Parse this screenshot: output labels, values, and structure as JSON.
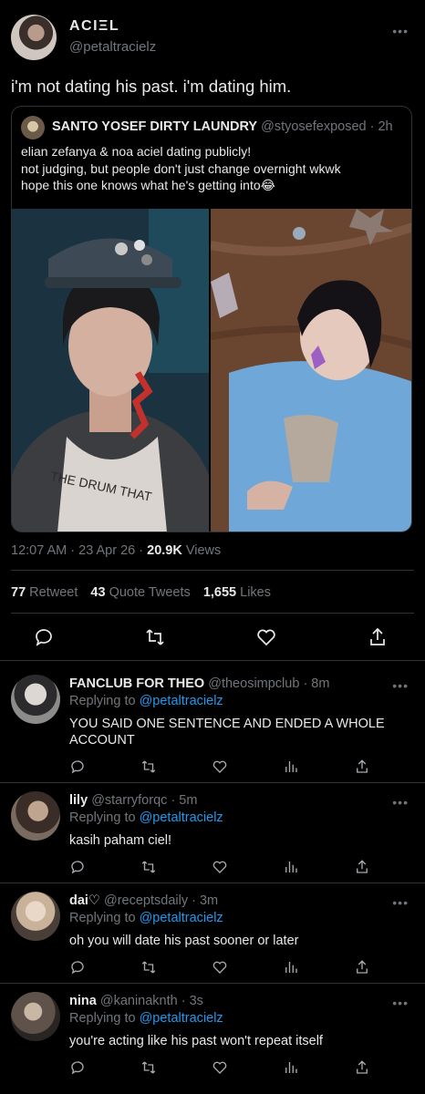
{
  "main_tweet": {
    "display_name": "ACIΞL",
    "handle": "@petaltracielz",
    "text": "i'm not dating his past. i'm dating him.",
    "more": "•••"
  },
  "quoted_tweet": {
    "display_name": "SANTO YOSEF DIRTY LAUNDRY",
    "handle": "@styosefexposed",
    "time": "· 2h",
    "lines": [
      "elian zefanya & noa aciel dating publicly!",
      "not judging, but people don't just change overnight wkwk",
      "hope this one knows what he's getting into😂"
    ],
    "left_image_overlay_text": "THE DRUM THAT"
  },
  "meta": {
    "timestamp": "12:07 AM · 23 Apr 26 ·",
    "views_count": "20.9K",
    "views_label": "Views"
  },
  "stats": {
    "retweets_count": "77",
    "retweets_label": "Retweet",
    "quotes_count": "43",
    "quotes_label": "Quote Tweets",
    "likes_count": "1,655",
    "likes_label": "Likes"
  },
  "replies": [
    {
      "name": "FANCLUB FOR THEO",
      "handle": "@theosimpclub",
      "time": "· 8m",
      "replying_prefix": "Replying to",
      "replying_to": "@petaltracielz",
      "text_lines": [
        "YOU SAID ONE SENTENCE AND ENDED A WHOLE",
        "ACCOUNT"
      ]
    },
    {
      "name": "lily",
      "handle": "@starryforqc",
      "time": "· 5m",
      "replying_prefix": "Replying to",
      "replying_to": "@petaltracielz",
      "text_lines": [
        "kasih paham ciel!"
      ]
    },
    {
      "name": "dai♡",
      "handle": "@receptsdaily",
      "time": "· 3m",
      "replying_prefix": "Replying to",
      "replying_to": "@petaltracielz",
      "text_lines": [
        "oh you will date his past sooner or later"
      ]
    },
    {
      "name": "nina",
      "handle": "@kaninaknth",
      "time": "· 3s",
      "replying_prefix": "Replying to",
      "replying_to": "@petaltracielz",
      "text_lines": [
        "you're acting like his past won't repeat itself"
      ]
    }
  ],
  "colors": {
    "background": "#000000",
    "text": "#e7e9ea",
    "muted": "#71767b",
    "link": "#1d9bf0",
    "divider": "#2f3336"
  },
  "icons": [
    "reply-icon",
    "retweet-icon",
    "like-icon",
    "views-icon",
    "share-icon",
    "more-icon"
  ]
}
